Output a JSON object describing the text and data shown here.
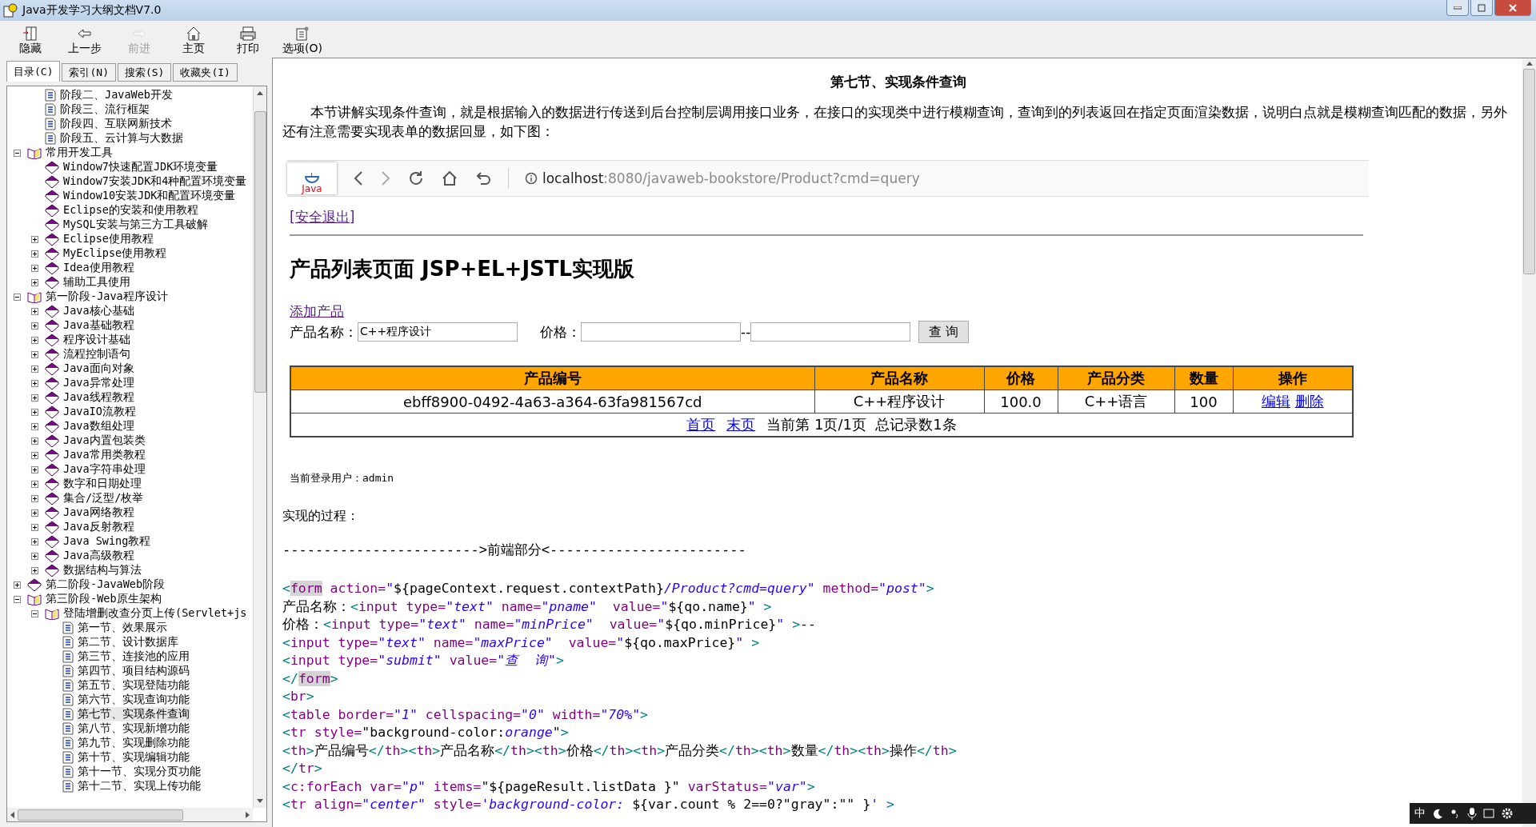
{
  "window": {
    "title": "Java开发学习大纲文档V7.0"
  },
  "toolbar": [
    {
      "label": "隐藏",
      "disabled": false
    },
    {
      "label": "上一步",
      "disabled": false
    },
    {
      "label": "前进",
      "disabled": true
    },
    {
      "label": "主页",
      "disabled": false
    },
    {
      "label": "打印",
      "disabled": false
    },
    {
      "label": "选项(O)",
      "disabled": false
    }
  ],
  "tabs": [
    {
      "label": "目录(C)",
      "selected": true
    },
    {
      "label": "索引(N)",
      "selected": false
    },
    {
      "label": "搜索(S)",
      "selected": false
    },
    {
      "label": "收藏夹(I)",
      "selected": false
    }
  ],
  "tree": [
    {
      "kind": "offscreen",
      "children": [
        {
          "label": "阶段二、JavaWeb开发",
          "kind": "page",
          "selected": false
        },
        {
          "label": "阶段三、流行框架",
          "kind": "page",
          "selected": false
        },
        {
          "label": "阶段四、互联网新技术",
          "kind": "page",
          "selected": false
        },
        {
          "label": "阶段五、云计算与大数据",
          "kind": "page",
          "selected": false
        }
      ]
    },
    {
      "label": "常用开发工具",
      "kind": "book",
      "expanded": true,
      "selected": false,
      "children": [
        {
          "label": "Window7快速配置JDK环境变量",
          "kind": "book",
          "selected": false
        },
        {
          "label": "Window7安装JDK和4种配置环境变量",
          "kind": "book",
          "selected": false
        },
        {
          "label": "Window10安装JDK和配置环境变量",
          "kind": "book",
          "selected": false
        },
        {
          "label": "Eclipse的安装和使用教程",
          "kind": "book",
          "selected": false
        },
        {
          "label": "MySQL安装与第三方工具破解",
          "kind": "book",
          "selected": false
        },
        {
          "label": "Eclipse使用教程",
          "kind": "book",
          "expanded": false,
          "selected": false
        },
        {
          "label": "MyEclipse使用教程",
          "kind": "book",
          "expanded": false,
          "selected": false
        },
        {
          "label": "Idea使用教程",
          "kind": "book",
          "expanded": false,
          "selected": false
        },
        {
          "label": "辅助工具使用",
          "kind": "book",
          "expanded": false,
          "selected": false
        }
      ]
    },
    {
      "label": "第一阶段-Java程序设计",
      "kind": "book",
      "expanded": true,
      "selected": false,
      "children": [
        {
          "label": "Java核心基础",
          "kind": "book",
          "expanded": false,
          "selected": false
        },
        {
          "label": "Java基础教程",
          "kind": "book",
          "expanded": false,
          "selected": false
        },
        {
          "label": "程序设计基础",
          "kind": "book",
          "expanded": false,
          "selected": false
        },
        {
          "label": "流程控制语句",
          "kind": "book",
          "expanded": false,
          "selected": false
        },
        {
          "label": "Java面向对象",
          "kind": "book",
          "expanded": false,
          "selected": false
        },
        {
          "label": "Java异常处理",
          "kind": "book",
          "expanded": false,
          "selected": false
        },
        {
          "label": "Java线程教程",
          "kind": "book",
          "expanded": false,
          "selected": false
        },
        {
          "label": "JavaIO流教程",
          "kind": "book",
          "expanded": false,
          "selected": false
        },
        {
          "label": "Java数组处理",
          "kind": "book",
          "expanded": false,
          "selected": false
        },
        {
          "label": "Java内置包装类",
          "kind": "book",
          "expanded": false,
          "selected": false
        },
        {
          "label": "Java常用类教程",
          "kind": "book",
          "expanded": false,
          "selected": false
        },
        {
          "label": "Java字符串处理",
          "kind": "book",
          "expanded": false,
          "selected": false
        },
        {
          "label": "数字和日期处理",
          "kind": "book",
          "expanded": false,
          "selected": false
        },
        {
          "label": "集合/泛型/枚举",
          "kind": "book",
          "expanded": false,
          "selected": false
        },
        {
          "label": "Java网络教程",
          "kind": "book",
          "expanded": false,
          "selected": false
        },
        {
          "label": "Java反射教程",
          "kind": "book",
          "expanded": false,
          "selected": false
        },
        {
          "label": "Java Swing教程",
          "kind": "book",
          "expanded": false,
          "selected": false
        },
        {
          "label": "Java高级教程",
          "kind": "book",
          "expanded": false,
          "selected": false
        },
        {
          "label": "数据结构与算法",
          "kind": "book",
          "expanded": false,
          "selected": false
        }
      ]
    },
    {
      "label": "第二阶段-JavaWeb阶段",
      "kind": "book",
      "expanded": false,
      "selected": false
    },
    {
      "label": "第三阶段-Web原生架构",
      "kind": "book",
      "expanded": true,
      "selected": false,
      "children": [
        {
          "label": "登陆增删改查分页上传(Servlet+js",
          "kind": "book",
          "expanded": true,
          "selected": false,
          "children": [
            {
              "label": "第一节、效果展示",
              "kind": "page",
              "selected": false
            },
            {
              "label": "第二节、设计数据库",
              "kind": "page",
              "selected": false
            },
            {
              "label": "第三节、连接池的应用",
              "kind": "page",
              "selected": false
            },
            {
              "label": "第四节、项目结构源码",
              "kind": "page",
              "selected": false
            },
            {
              "label": "第五节、实现登陆功能",
              "kind": "page",
              "selected": false
            },
            {
              "label": "第六节、实现查询功能",
              "kind": "page",
              "selected": false
            },
            {
              "label": "第七节、实现条件查询",
              "kind": "page",
              "selected": true
            },
            {
              "label": "第八节、实现新增功能",
              "kind": "page",
              "selected": false
            },
            {
              "label": "第九节、实现删除功能",
              "kind": "page",
              "selected": false
            },
            {
              "label": "第十节、实现编辑功能",
              "kind": "page",
              "selected": false
            },
            {
              "label": "第十一节、实现分页功能",
              "kind": "page",
              "selected": false
            },
            {
              "label": "第十二节、实现上传功能",
              "kind": "page",
              "selected": false
            }
          ]
        }
      ]
    }
  ],
  "article": {
    "title": "第七节、实现条件查询",
    "intro": "本节讲解实现条件查询，就是根据输入的数据进行传送到后台控制层调用接口业务，在接口的实现类中进行模糊查询，查询到的列表返回在指定页面渲染数据，说明白点就是模糊查询匹配的数据，另外还有注意需要实现表单的数据回显，如下图：",
    "demo": {
      "logo": "Java",
      "url_host": "localhost",
      "url_rest": ":8080/javaweb-bookstore/Product?cmd=query",
      "logout": "[安全退出]",
      "heading": "产品列表页面 JSP+EL+JSTL实现版",
      "add_link": "添加产品",
      "name_label": "产品名称：",
      "name_value": "C++程序设计",
      "price_label": "价格：",
      "price_sep": "--",
      "query_button": "查 询",
      "columns": [
        "产品编号",
        "产品名称",
        "价格",
        "产品分类",
        "数量",
        "操作"
      ],
      "rows": [
        {
          "cells": [
            "ebff8900-0492-4a63-a364-63fa981567cd",
            "C++程序设计",
            "100.0",
            "C++语言",
            "100"
          ],
          "actions": [
            "编辑",
            "删除"
          ]
        }
      ],
      "pager": {
        "first": "首页",
        "last": "末页",
        "info": "当前第 1页/1页  总记录数1条"
      },
      "user": "当前登录用户：admin"
    },
    "process": "实现的过程：",
    "divider": "------------------------>前端部分<------------------------",
    "code": [
      [
        {
          "kind": "punct",
          "text": "<"
        },
        {
          "kind": "hl",
          "text": "form"
        },
        {
          "kind": "name",
          "text": " action="
        },
        {
          "kind": "value",
          "text": "\""
        },
        {
          "kind": "plain",
          "text": "${pageContext.request.contextPath}"
        },
        {
          "kind": "value",
          "text": "/Product?cmd=query\""
        },
        {
          "kind": "name",
          "text": " method="
        },
        {
          "kind": "value",
          "text": "\"post\""
        },
        {
          "kind": "punct",
          "text": ">"
        }
      ],
      [
        {
          "kind": "plain",
          "text": "产品名称："
        },
        {
          "kind": "punct",
          "text": "<"
        },
        {
          "kind": "name",
          "text": "input type="
        },
        {
          "kind": "value",
          "text": "\"text\""
        },
        {
          "kind": "name",
          "text": " name="
        },
        {
          "kind": "value",
          "text": "\"pname\""
        },
        {
          "kind": "name",
          "text": "  value="
        },
        {
          "kind": "value",
          "text": "\""
        },
        {
          "kind": "plain",
          "text": "${qo.name}"
        },
        {
          "kind": "value",
          "text": "\""
        },
        {
          "kind": "punct",
          "text": " >"
        }
      ],
      [
        {
          "kind": "plain",
          "text": "价格："
        },
        {
          "kind": "punct",
          "text": "<"
        },
        {
          "kind": "name",
          "text": "input type="
        },
        {
          "kind": "value",
          "text": "\"text\""
        },
        {
          "kind": "name",
          "text": " name="
        },
        {
          "kind": "value",
          "text": "\"minPrice\""
        },
        {
          "kind": "name",
          "text": "  value="
        },
        {
          "kind": "value",
          "text": "\""
        },
        {
          "kind": "plain",
          "text": "${qo.minPrice}"
        },
        {
          "kind": "value",
          "text": "\""
        },
        {
          "kind": "punct",
          "text": " >"
        },
        {
          "kind": "plain",
          "text": "--"
        }
      ],
      [
        {
          "kind": "punct",
          "text": "<"
        },
        {
          "kind": "name",
          "text": "input type="
        },
        {
          "kind": "value",
          "text": "\"text\""
        },
        {
          "kind": "name",
          "text": " name="
        },
        {
          "kind": "value",
          "text": "\"maxPrice\""
        },
        {
          "kind": "name",
          "text": "  value="
        },
        {
          "kind": "value",
          "text": "\""
        },
        {
          "kind": "plain",
          "text": "${qo.maxPrice}"
        },
        {
          "kind": "value",
          "text": "\""
        },
        {
          "kind": "punct",
          "text": " >"
        }
      ],
      [
        {
          "kind": "punct",
          "text": "<"
        },
        {
          "kind": "name",
          "text": "input type="
        },
        {
          "kind": "value",
          "text": "\"submit\""
        },
        {
          "kind": "name",
          "text": " value="
        },
        {
          "kind": "value",
          "text": "\"查  询\""
        },
        {
          "kind": "punct",
          "text": ">"
        }
      ],
      [
        {
          "kind": "punct",
          "text": "</"
        },
        {
          "kind": "hl",
          "text": "form"
        },
        {
          "kind": "punct",
          "text": ">"
        }
      ],
      [
        {
          "kind": "punct",
          "text": "<"
        },
        {
          "kind": "name",
          "text": "br"
        },
        {
          "kind": "punct",
          "text": ">"
        }
      ],
      [
        {
          "kind": "punct",
          "text": "<"
        },
        {
          "kind": "name",
          "text": "table border="
        },
        {
          "kind": "value",
          "text": "\"1\""
        },
        {
          "kind": "name",
          "text": " cellspacing="
        },
        {
          "kind": "value",
          "text": "\"0\""
        },
        {
          "kind": "name",
          "text": " width="
        },
        {
          "kind": "value",
          "text": "\"70%\""
        },
        {
          "kind": "punct",
          "text": ">"
        }
      ],
      [
        {
          "kind": "punct",
          "text": "<"
        },
        {
          "kind": "name",
          "text": "tr style="
        },
        {
          "kind": "plain",
          "text": "\"background-color:"
        },
        {
          "kind": "value",
          "text": "orange"
        },
        {
          "kind": "plain",
          "text": "\""
        },
        {
          "kind": "punct",
          "text": ">"
        }
      ],
      [
        {
          "kind": "punct",
          "text": "<"
        },
        {
          "kind": "name",
          "text": "th"
        },
        {
          "kind": "punct",
          "text": ">"
        },
        {
          "kind": "plain",
          "text": "产品编号"
        },
        {
          "kind": "punct",
          "text": "</"
        },
        {
          "kind": "name",
          "text": "th"
        },
        {
          "kind": "punct",
          "text": "><"
        },
        {
          "kind": "name",
          "text": "th"
        },
        {
          "kind": "punct",
          "text": ">"
        },
        {
          "kind": "plain",
          "text": "产品名称"
        },
        {
          "kind": "punct",
          "text": "</"
        },
        {
          "kind": "name",
          "text": "th"
        },
        {
          "kind": "punct",
          "text": "><"
        },
        {
          "kind": "name",
          "text": "th"
        },
        {
          "kind": "punct",
          "text": ">"
        },
        {
          "kind": "plain",
          "text": "价格"
        },
        {
          "kind": "punct",
          "text": "</"
        },
        {
          "kind": "name",
          "text": "th"
        },
        {
          "kind": "punct",
          "text": "><"
        },
        {
          "kind": "name",
          "text": "th"
        },
        {
          "kind": "punct",
          "text": ">"
        },
        {
          "kind": "plain",
          "text": "产品分类"
        },
        {
          "kind": "punct",
          "text": "</"
        },
        {
          "kind": "name",
          "text": "th"
        },
        {
          "kind": "punct",
          "text": "><"
        },
        {
          "kind": "name",
          "text": "th"
        },
        {
          "kind": "punct",
          "text": ">"
        },
        {
          "kind": "plain",
          "text": "数量"
        },
        {
          "kind": "punct",
          "text": "</"
        },
        {
          "kind": "name",
          "text": "th"
        },
        {
          "kind": "punct",
          "text": "><"
        },
        {
          "kind": "name",
          "text": "th"
        },
        {
          "kind": "punct",
          "text": ">"
        },
        {
          "kind": "plain",
          "text": "操作"
        },
        {
          "kind": "punct",
          "text": "</"
        },
        {
          "kind": "name",
          "text": "th"
        },
        {
          "kind": "punct",
          "text": ">"
        }
      ],
      [
        {
          "kind": "punct",
          "text": "</"
        },
        {
          "kind": "name",
          "text": "tr"
        },
        {
          "kind": "punct",
          "text": ">"
        }
      ],
      [
        {
          "kind": "punct",
          "text": "<"
        },
        {
          "kind": "name",
          "text": "c:forEach var="
        },
        {
          "kind": "value",
          "text": "\"p\""
        },
        {
          "kind": "name",
          "text": " items="
        },
        {
          "kind": "plain",
          "text": "\"${pageResult.listData }\""
        },
        {
          "kind": "name",
          "text": " varStatus="
        },
        {
          "kind": "value",
          "text": "\"var\""
        },
        {
          "kind": "punct",
          "text": ">"
        }
      ],
      [
        {
          "kind": "punct",
          "text": "<"
        },
        {
          "kind": "name",
          "text": "tr align="
        },
        {
          "kind": "value",
          "text": "\"center\""
        },
        {
          "kind": "name",
          "text": " style="
        },
        {
          "kind": "value",
          "text": "'background-color: "
        },
        {
          "kind": "plain",
          "text": "${var.count % 2==0?\"gray\":\"\" }"
        },
        {
          "kind": "value",
          "text": "'"
        },
        {
          "kind": "punct",
          "text": " >"
        }
      ]
    ]
  },
  "ime_bar": {
    "label": "中"
  }
}
